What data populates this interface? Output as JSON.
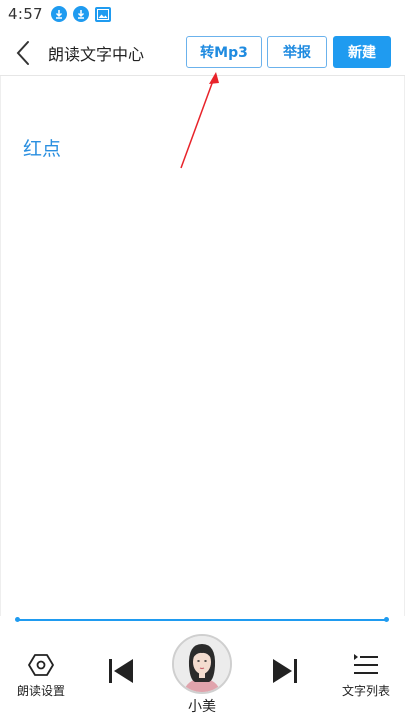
{
  "status_bar": {
    "time": "4:57",
    "icons": [
      "download-icon",
      "download-icon",
      "image-icon"
    ]
  },
  "header": {
    "title": "朗读文字中心",
    "back_icon": "chevron-left-icon",
    "buttons": {
      "to_mp3": "转Mp3",
      "report": "举报",
      "new": "新建"
    }
  },
  "content": {
    "text": "红点"
  },
  "player": {
    "progress_fraction": 1.0,
    "settings_label": "朗读设置",
    "voice_name": "小美",
    "list_label": "文字列表"
  },
  "colors": {
    "accent": "#1f9bf0",
    "annotation": "#e8232a"
  }
}
